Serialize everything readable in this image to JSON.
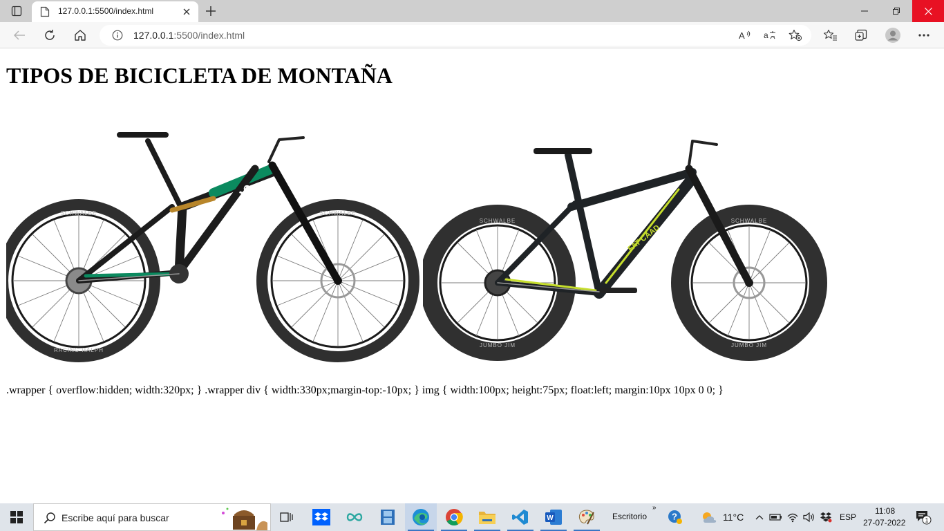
{
  "browser": {
    "tab": {
      "title": "127.0.0.1:5500/index.html"
    },
    "address": {
      "host": "127.0.0.1",
      "path": ":5500/index.html"
    }
  },
  "page": {
    "heading": "TIPOS DE BICICLETA DE MONTAÑA",
    "bikes": [
      {
        "brand_mark": "cannondale",
        "frame_color": "#0b8a5f",
        "tire_brand": "SCHWALBE",
        "tire_model": "RACING RALPH"
      },
      {
        "brand_mark": "FAT CAAD",
        "frame_color": "#1f2326",
        "accent_color": "#c6de2c",
        "tire_brand": "SCHWALBE",
        "tire_model": "JUMBO JIM"
      }
    ],
    "css_text": ".wrapper { overflow:hidden; width:320px; } .wrapper div { width:330px;margin-top:-10px; } img { width:100px; height:75px; float:left; margin:10px 10px 0 0; }"
  },
  "taskbar": {
    "search_placeholder": "Escribe aquí para buscar",
    "desktop_label": "Escritorio",
    "weather": "11°C",
    "language": "ESP",
    "time": "11:08",
    "date": "27-07-2022",
    "notification_count": "1"
  }
}
